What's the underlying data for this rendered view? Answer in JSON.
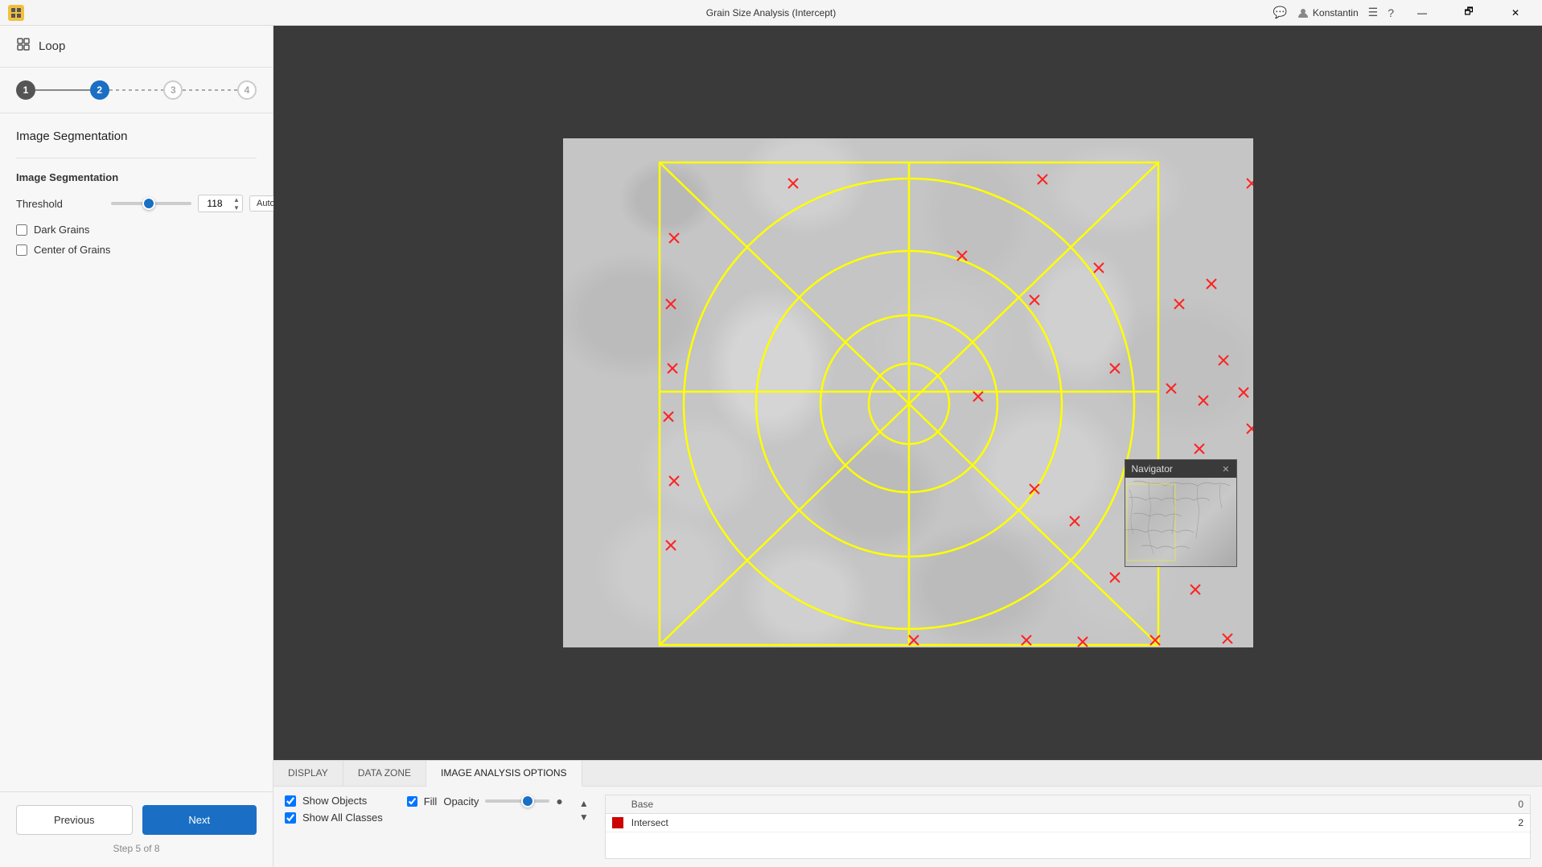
{
  "titlebar": {
    "title": "Grain Size Analysis (Intercept)",
    "user": "Konstantin",
    "home_icon": "⊞",
    "chat_icon": "💬",
    "menu_icon": "☰",
    "help_icon": "?",
    "min_icon": "—",
    "max_icon": "🗗",
    "close_icon": "✕"
  },
  "sidebar": {
    "loop_label": "Loop",
    "steps": [
      {
        "id": 1,
        "state": "done"
      },
      {
        "id": 2,
        "state": "active"
      },
      {
        "id": 3,
        "state": "pending"
      },
      {
        "id": 4,
        "state": "pending"
      }
    ],
    "page_title": "Image Segmentation",
    "section_title": "Image Segmentation",
    "threshold_label": "Threshold",
    "threshold_value": "118",
    "auto_btn": "Auto",
    "dark_grains_label": "Dark Grains",
    "center_of_grains_label": "Center of Grains",
    "prev_btn": "Previous",
    "next_btn": "Next",
    "step_info": "Step 5 of 8"
  },
  "tabs": [
    {
      "id": "display",
      "label": "DISPLAY",
      "active": false
    },
    {
      "id": "data-zone",
      "label": "DATA ZONE",
      "active": false
    },
    {
      "id": "image-analysis",
      "label": "IMAGE ANALYSIS OPTIONS",
      "active": true
    }
  ],
  "bottom": {
    "show_objects_label": "Show Objects",
    "show_all_classes_label": "Show All Classes",
    "fill_label": "Fill",
    "opacity_label": "Opacity",
    "class_table": {
      "col_name": "Base",
      "col_value": "0",
      "rows": [
        {
          "color": "#cc0000",
          "name": "Intersect",
          "value": "2"
        }
      ]
    }
  },
  "navigator": {
    "title": "Navigator",
    "close": "✕"
  }
}
